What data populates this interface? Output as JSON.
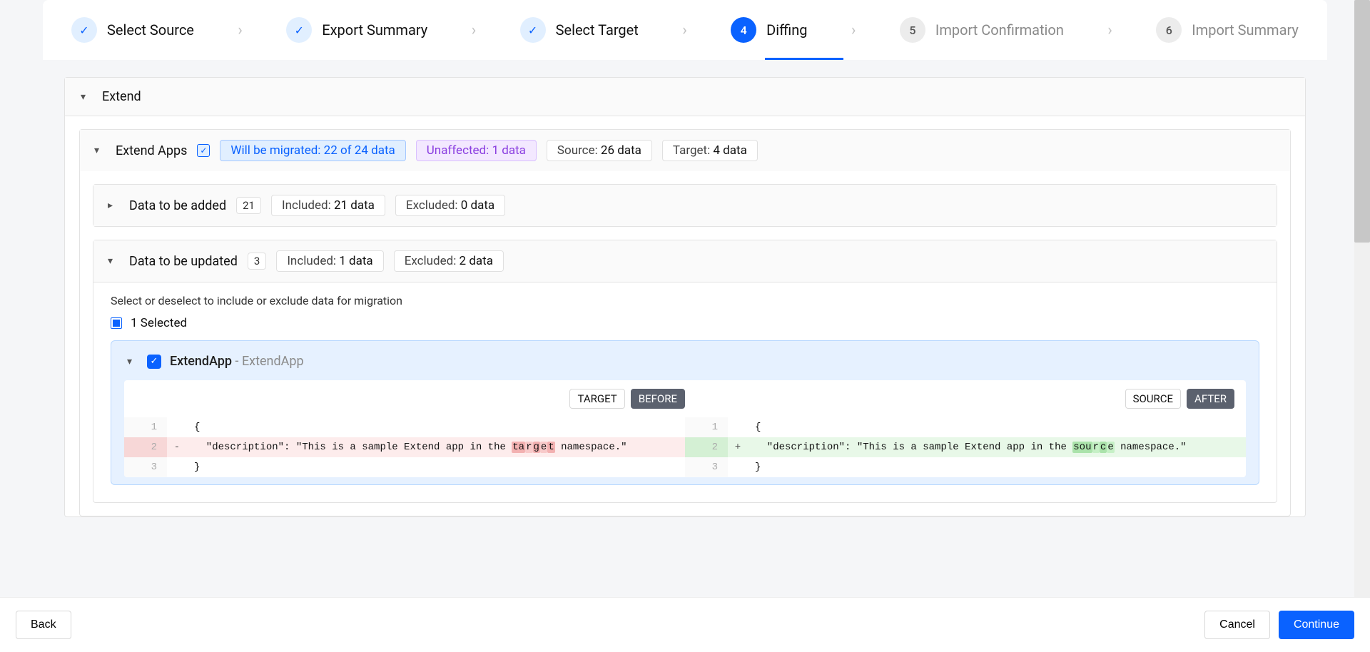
{
  "stepper": {
    "steps": [
      {
        "badge": "check",
        "label": "Select Source",
        "state": "done"
      },
      {
        "badge": "check",
        "label": "Export Summary",
        "state": "done"
      },
      {
        "badge": "check",
        "label": "Select Target",
        "state": "done"
      },
      {
        "badge": "4",
        "label": "Diffing",
        "state": "active"
      },
      {
        "badge": "5",
        "label": "Import Confirmation",
        "state": "future"
      },
      {
        "badge": "6",
        "label": "Import Summary",
        "state": "future"
      }
    ]
  },
  "section": {
    "title": "Extend",
    "apps": {
      "title": "Extend Apps",
      "migrated_label": "Will be migrated: ",
      "migrated_value": "22 of 24 data",
      "unaffected_label": "Unaffected: ",
      "unaffected_value": "1 data",
      "source_label": "Source: ",
      "source_value": "26 data",
      "target_label": "Target: ",
      "target_value": "4 data"
    },
    "added": {
      "title": "Data to be added",
      "count": "21",
      "included_label": "Included: ",
      "included_value": "21 data",
      "excluded_label": "Excluded: ",
      "excluded_value": "0 data"
    },
    "updated": {
      "title": "Data to be updated",
      "count": "3",
      "included_label": "Included: ",
      "included_value": "1 data",
      "excluded_label": "Excluded: ",
      "excluded_value": "2 data",
      "instructions": "Select or deselect to include or exclude data for migration",
      "selected_text": "1 Selected"
    },
    "diff_item": {
      "name": "ExtendApp",
      "kind": " - ExtendApp",
      "target_tag": "TARGET",
      "before_tag": "BEFORE",
      "source_tag": "SOURCE",
      "after_tag": "AFTER",
      "left": {
        "line1_gutter": "1",
        "line1_code": "{",
        "line2_gutter": "2",
        "line2_sign": "-",
        "line2_pre": "  \"description\": \"This is a sample Extend app in the ",
        "line2_w1": "ta",
        "line2_w2": "r",
        "line2_w3": "g",
        "line2_w4": "e",
        "line2_w5": "t",
        "line2_post": " namespace.\"",
        "line3_gutter": "3",
        "line3_code": "}"
      },
      "right": {
        "line1_gutter": "1",
        "line1_code": "{",
        "line2_gutter": "2",
        "line2_sign": "+",
        "line2_pre": "  \"description\": \"This is a sample Extend app in the ",
        "line2_w1": "sou",
        "line2_w2": "r",
        "line2_w3": "c",
        "line2_w4": "e",
        "line2_post": " namespace.\"",
        "line3_gutter": "3",
        "line3_code": "}"
      }
    }
  },
  "footer": {
    "back": "Back",
    "cancel": "Cancel",
    "continue": "Continue"
  }
}
